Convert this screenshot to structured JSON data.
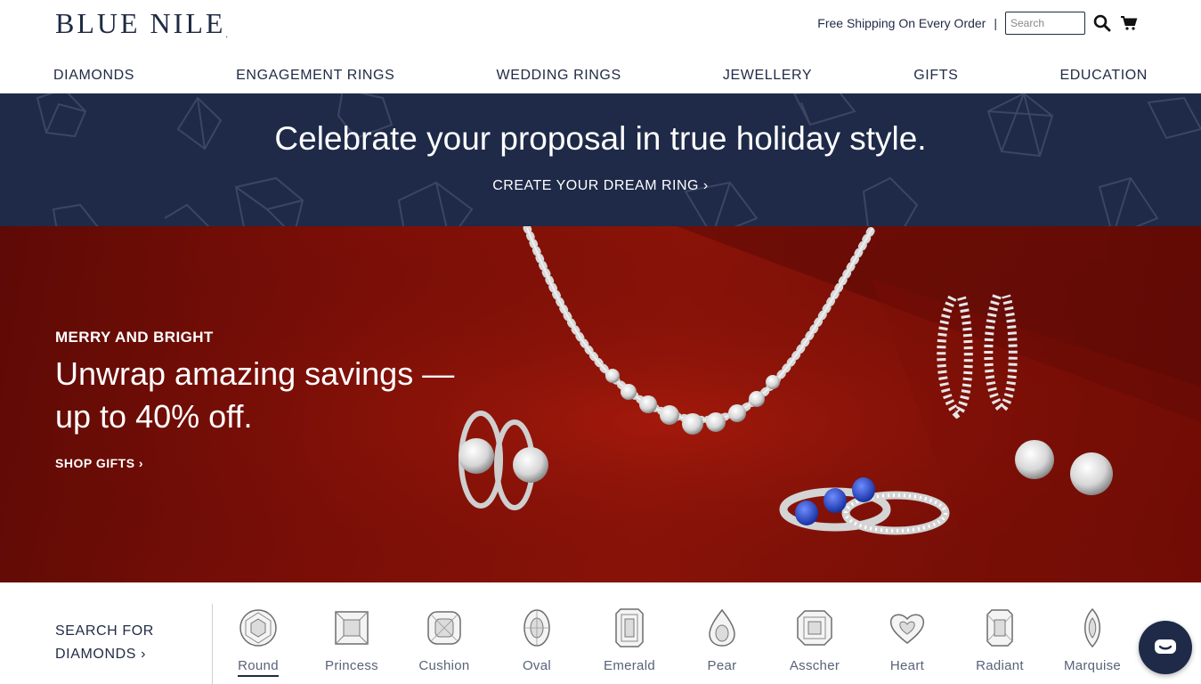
{
  "header": {
    "logo": "BLUE NILE",
    "logo_mark": ".",
    "shipping_text": "Free Shipping On Every Order",
    "separator": "|",
    "search_placeholder": "Search"
  },
  "nav": {
    "items": [
      {
        "label": "DIAMONDS"
      },
      {
        "label": "ENGAGEMENT RINGS"
      },
      {
        "label": "WEDDING RINGS"
      },
      {
        "label": "JEWELLERY"
      },
      {
        "label": "GIFTS"
      },
      {
        "label": "EDUCATION"
      }
    ]
  },
  "promo": {
    "title": "Celebrate your proposal in true holiday style.",
    "cta": "CREATE YOUR DREAM RING  ›"
  },
  "hero": {
    "kicker": "MERRY AND BRIGHT",
    "headline": "Unwrap amazing savings — up to 40% off.",
    "cta": "SHOP GIFTS  ›"
  },
  "shapes": {
    "label_line1": "SEARCH FOR",
    "label_line2": "DIAMONDS  ›",
    "items": [
      {
        "label": "Round"
      },
      {
        "label": "Princess"
      },
      {
        "label": "Cushion"
      },
      {
        "label": "Oval"
      },
      {
        "label": "Emerald"
      },
      {
        "label": "Pear"
      },
      {
        "label": "Asscher"
      },
      {
        "label": "Heart"
      },
      {
        "label": "Radiant"
      },
      {
        "label": "Marquise"
      }
    ],
    "selected": "Round"
  },
  "colors": {
    "navy": "#1e2a48",
    "hero_red": "#8e1408",
    "text": "#1f2a44"
  }
}
